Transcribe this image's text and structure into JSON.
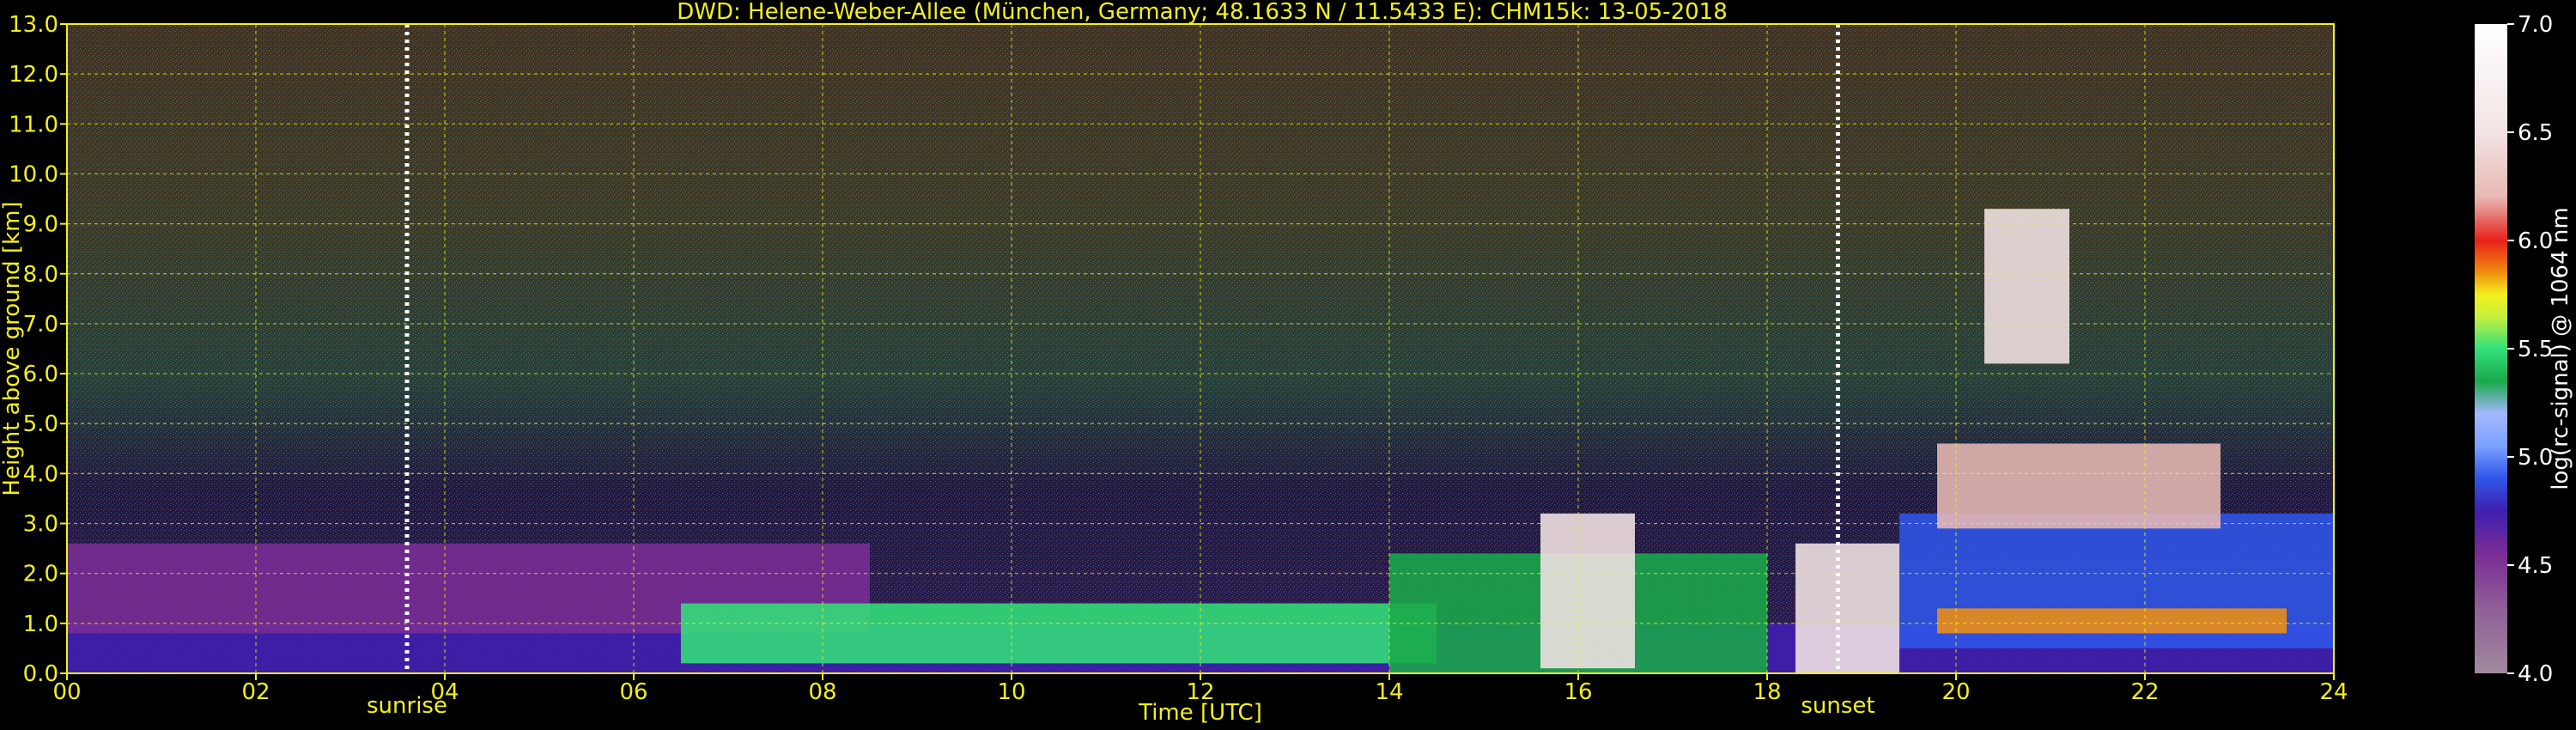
{
  "chart_data": {
    "type": "heatmap",
    "title": "DWD: Helene-Weber-Allee (München, Germany; 48.1633 N / 11.5433 E):    CHM15k: 13-05-2018",
    "xlabel": "Time [UTC]",
    "ylabel": "Height above ground [km]",
    "xlim": [
      0,
      24
    ],
    "ylim": [
      0,
      13
    ],
    "x_ticks": [
      "00",
      "02",
      "04",
      "06",
      "08",
      "10",
      "12",
      "14",
      "16",
      "18",
      "20",
      "22",
      "24"
    ],
    "y_ticks": [
      "0.0",
      "1.0",
      "2.0",
      "3.0",
      "4.0",
      "5.0",
      "6.0",
      "7.0",
      "8.0",
      "9.0",
      "10.0",
      "11.0",
      "12.0",
      "13.0"
    ],
    "grid": true,
    "markers": [
      {
        "label": "sunrise",
        "time": 3.6
      },
      {
        "label": "sunset",
        "time": 18.75
      }
    ],
    "colorbar": {
      "label": "log(rc-signal) @ 1064 nm",
      "range": [
        4.0,
        7.0
      ],
      "ticks": [
        "4.0",
        "4.5",
        "5.0",
        "5.5",
        "6.0",
        "6.5",
        "7.0"
      ],
      "stops": [
        {
          "v": 4.0,
          "c": "#a08a9e"
        },
        {
          "v": 4.3,
          "c": "#8f5f97"
        },
        {
          "v": 4.55,
          "c": "#7a2c95"
        },
        {
          "v": 4.75,
          "c": "#3f1fb0"
        },
        {
          "v": 4.9,
          "c": "#2f55e8"
        },
        {
          "v": 5.05,
          "c": "#7aa0ff"
        },
        {
          "v": 5.2,
          "c": "#a4b8ff"
        },
        {
          "v": 5.35,
          "c": "#1aa84a"
        },
        {
          "v": 5.5,
          "c": "#33e07a"
        },
        {
          "v": 5.65,
          "c": "#c7f03c"
        },
        {
          "v": 5.75,
          "c": "#f3f01c"
        },
        {
          "v": 5.85,
          "c": "#f09010"
        },
        {
          "v": 6.0,
          "c": "#e8201a"
        },
        {
          "v": 6.2,
          "c": "#e8b8b4"
        },
        {
          "v": 6.5,
          "c": "#f3e4e4"
        },
        {
          "v": 7.0,
          "c": "#ffffff"
        }
      ]
    },
    "layers": [
      {
        "name": "boundary-layer-low",
        "t0": 0,
        "t1": 24,
        "h0": 0.0,
        "h1": 1.0,
        "value": 4.85
      },
      {
        "name": "residual-layer",
        "t0": 0,
        "t1": 8.5,
        "h0": 0.8,
        "h1": 2.6,
        "value": 4.55
      },
      {
        "name": "mixed-layer-aerosol",
        "t0": 6.5,
        "t1": 14.5,
        "h0": 0.2,
        "h1": 1.4,
        "value": 5.6
      },
      {
        "name": "afternoon-aerosol",
        "t0": 14.0,
        "t1": 18.0,
        "h0": 0.0,
        "h1": 2.4,
        "value": 5.45
      },
      {
        "name": "low-cloud-16",
        "t0": 15.6,
        "t1": 16.6,
        "h0": 0.1,
        "h1": 3.2,
        "value": 6.9
      },
      {
        "name": "low-cloud-19",
        "t0": 18.3,
        "t1": 19.4,
        "h0": 0.0,
        "h1": 2.6,
        "value": 6.9
      },
      {
        "name": "evening-layer",
        "t0": 19.4,
        "t1": 24,
        "h0": 0.5,
        "h1": 3.2,
        "value": 4.9
      },
      {
        "name": "evening-aerosol",
        "t0": 19.8,
        "t1": 23.5,
        "h0": 0.8,
        "h1": 1.3,
        "value": 5.9
      },
      {
        "name": "cloud-20h",
        "t0": 20.3,
        "t1": 21.2,
        "h0": 6.2,
        "h1": 9.3,
        "value": 6.7
      },
      {
        "name": "cloud-20h-top",
        "t0": 19.8,
        "t1": 22.8,
        "h0": 2.9,
        "h1": 4.6,
        "value": 6.4
      }
    ]
  }
}
